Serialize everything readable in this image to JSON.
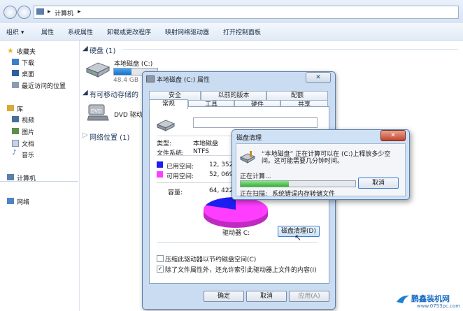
{
  "address": {
    "crumb": "计算机",
    "arrow1": "▸",
    "arrow2": "▸"
  },
  "toolbar": {
    "organize": "组织 ▾",
    "properties": "属性",
    "system_properties": "系统属性",
    "uninstall": "卸载或更改程序",
    "map_drive": "映射网络驱动器",
    "control_panel": "打开控制面板"
  },
  "sidebar": {
    "favorites": "收藏夹",
    "downloads": "下载",
    "desktop": "桌面",
    "recent": "最近访问的位置",
    "library": "库",
    "videos": "视频",
    "pictures": "图片",
    "documents": "文档",
    "music": "音乐",
    "computer": "计算机",
    "network": "网络"
  },
  "main": {
    "hdd_group": "硬盘 (1)",
    "local_disk": "本地磁盘 (C:)",
    "disk_free": "48.4 GB",
    "removable_group": "有可移动存储的",
    "dvd": "DVD 驱动",
    "network_group": "网络位置 (1)"
  },
  "prop": {
    "title": "本地磁盘 (C:) 属性",
    "tabs_row1": [
      "安全",
      "以前的版本",
      "配额"
    ],
    "tabs_row2": [
      "常规",
      "工具",
      "硬件",
      "共享"
    ],
    "type_label": "类型:",
    "type_value": "本地磁盘",
    "fs_label": "文件系统:",
    "fs_value": "NTFS",
    "used_label": "已用空间:",
    "used_value": "12, 352,",
    "free_label": "可用空间:",
    "free_value": "52, 069,",
    "capacity_label": "容量:",
    "capacity_value": "64, 422,",
    "drive_label": "驱动器 C:",
    "cleanup_button": "磁盘清理(D)",
    "compress_check": "压缩此驱动器以节约磁盘空间(C)",
    "index_check": "除了文件属性外，还允许索引此驱动器上文件的内容(I)",
    "ok": "确定",
    "cancel": "取消",
    "apply": "应用(A)",
    "used_fraction": 0.192
  },
  "clean": {
    "title": "磁盘清理",
    "msg1": "“本地磁盘” 正在计算可以在 (C:)上释放多少空",
    "msg2": "间。这可能需要几分钟时间。",
    "calculating": "正在计算...",
    "cancel": "取消",
    "scanning_label": "正在扫描:",
    "scanning_value": "系统错误内存转储文件",
    "progress": 0.42,
    "close": "✕"
  },
  "watermark": {
    "name": "鹏鑫装机网",
    "url": "www.0753pc.com"
  },
  "colors": {
    "used": "#1d1ef0",
    "free": "#ff3dff",
    "progress": "#2fb52f"
  }
}
